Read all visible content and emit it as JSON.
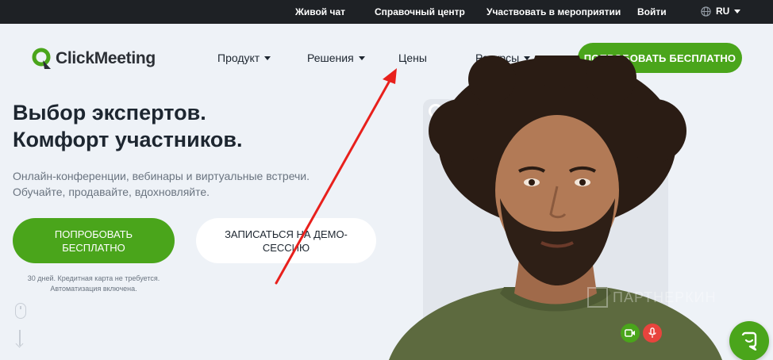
{
  "topbar": {
    "live_chat": "Живой чат",
    "help_center": "Справочный центр",
    "events": "Участвовать в мероприятии",
    "login": "Войти",
    "language": "RU"
  },
  "nav": {
    "logo_text": "ClickMeeting",
    "product": "Продукт",
    "solutions": "Решения",
    "prices": "Цены",
    "resources": "Ресурсы",
    "cta": "ПОПРОБОВАТЬ БЕСПЛАТНО"
  },
  "hero": {
    "headline_line1": "Выбор экспертов.",
    "headline_line2": "Комфорт участников.",
    "subtitle": "Онлайн-конференции, вебинары и виртуальные встречи. Обучайте, продавайте, вдохновляйте.",
    "try_button": "ПОПРОБОВАТЬ БЕСПЛАТНО",
    "demo_button": "ЗАПИСАТЬСЯ НА ДЕМО-СЕССИЮ",
    "note_line1": "30 дней. Кредитная карта не требуется.",
    "note_line2": "Автоматизация включена."
  },
  "watermark": "ПАРТНЕРКИН",
  "colors": {
    "accent_green": "#4aa51b",
    "topbar_bg": "#1e2125",
    "page_bg": "#eef2f7",
    "annotation_red": "#e8201c",
    "mic_red": "#e8443d"
  },
  "icons": [
    "globe-icon",
    "logo-icon",
    "camera-icon",
    "microphone-icon",
    "chat-icon",
    "mouse-icon",
    "arrow-down-icon"
  ]
}
